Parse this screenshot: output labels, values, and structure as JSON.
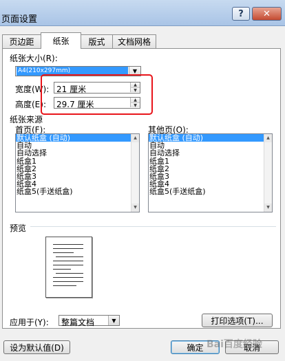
{
  "window": {
    "title": "页面设置",
    "help_glyph": "?",
    "close_glyph": "✕"
  },
  "tabs": [
    {
      "label": "页边距",
      "active": false
    },
    {
      "label": "纸张",
      "active": true
    },
    {
      "label": "版式",
      "active": false
    },
    {
      "label": "文档网格",
      "active": false
    }
  ],
  "paper_size": {
    "label": "纸张大小(R):",
    "value": "A4(210x297mm)",
    "arrow": "▼"
  },
  "width": {
    "label": "宽度(W):",
    "value": "21 厘米"
  },
  "height": {
    "label": "高度(E):",
    "value": "29.7 厘米"
  },
  "spinner_glyphs": {
    "up": "▲",
    "down": "▼"
  },
  "paper_source": {
    "section_label": "纸张来源",
    "first_page_label": "首页(F):",
    "other_pages_label": "其他页(O):",
    "first_page_items": [
      "默认纸盒 (自动)",
      "自动",
      "自动选择",
      "纸盒1",
      "纸盒2",
      "纸盒3",
      "纸盒4",
      "纸盒5(手送纸盒)"
    ],
    "other_pages_items": [
      "默认纸盒 (自动)",
      "自动",
      "自动选择",
      "纸盒1",
      "纸盒2",
      "纸盒3",
      "纸盒4",
      "纸盒5(手送纸盒)"
    ],
    "selected_index": 0
  },
  "preview": {
    "label": "预览"
  },
  "apply_to": {
    "label": "应用于(Y):",
    "value": "整篇文档",
    "arrow": "▼"
  },
  "buttons": {
    "print_options": "打印选项(T)...",
    "set_default": "设为默认值(D)",
    "ok": "确定",
    "cancel": "取消"
  },
  "watermark": {
    "text": "Bai百度经验"
  }
}
